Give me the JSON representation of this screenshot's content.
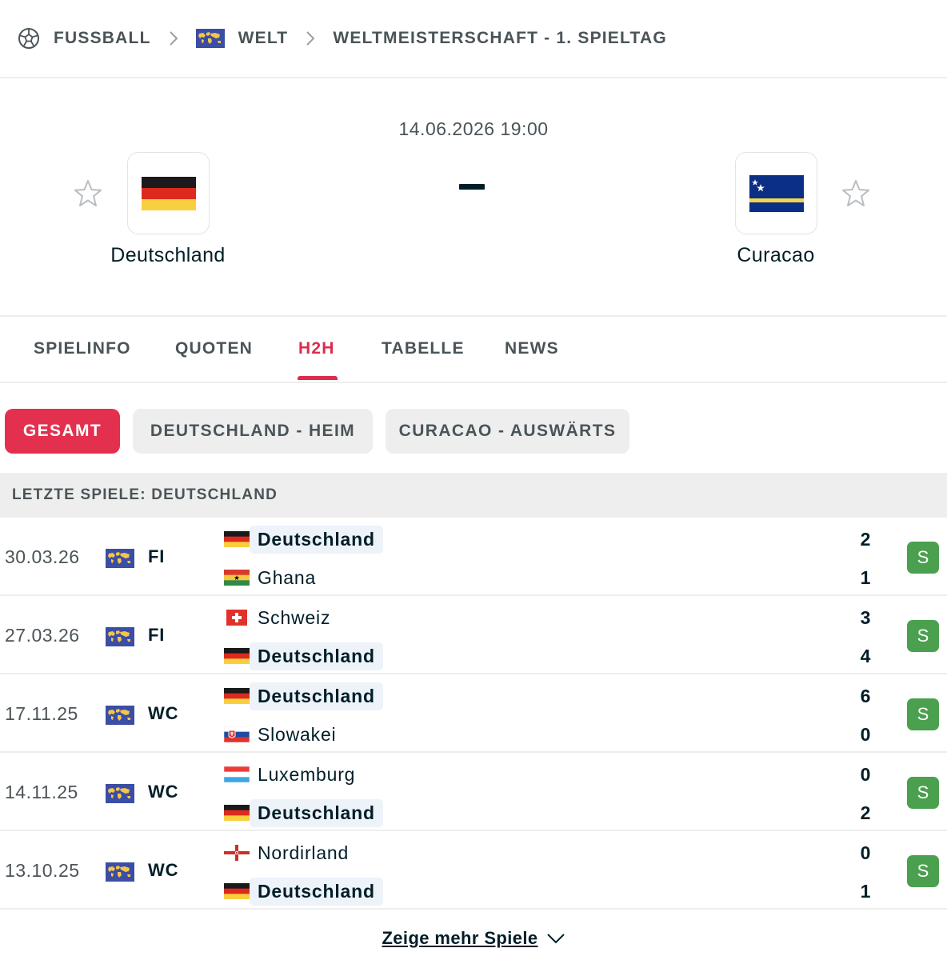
{
  "breadcrumb": {
    "sport": "FUSSBALL",
    "region": "WELT",
    "competition": "WELTMEISTERSCHAFT - 1. SPIELTAG",
    "icons": [
      "soccer-ball-icon",
      "world-flag-icon",
      "chevron-right-icon"
    ]
  },
  "match": {
    "datetime": "14.06.2026 19:00",
    "score_separator": "–",
    "home": {
      "name": "Deutschland",
      "flag": "germany-flag"
    },
    "away": {
      "name": "Curacao",
      "flag": "curacao-flag"
    }
  },
  "tabs": [
    {
      "label": "SPIELINFO",
      "active": false
    },
    {
      "label": "QUOTEN",
      "active": false
    },
    {
      "label": "H2H",
      "active": true
    },
    {
      "label": "TABELLE",
      "active": false
    },
    {
      "label": "NEWS",
      "active": false
    }
  ],
  "filters": [
    {
      "label": "GESAMT",
      "active": true
    },
    {
      "label": "DEUTSCHLAND - HEIM",
      "active": false
    },
    {
      "label": "CURACAO - AUSWÄRTS",
      "active": false
    }
  ],
  "section": {
    "title": "LETZTE SPIELE: DEUTSCHLAND"
  },
  "matches": [
    {
      "date": "30.03.26",
      "comp": "FI",
      "home": "Deutschland",
      "away": "Ghana",
      "home_score": "2",
      "away_score": "1",
      "result": "S"
    },
    {
      "date": "27.03.26",
      "comp": "FI",
      "home": "Schweiz",
      "away": "Deutschland",
      "home_score": "3",
      "away_score": "4",
      "result": "S"
    },
    {
      "date": "17.11.25",
      "comp": "WC",
      "home": "Deutschland",
      "away": "Slowakei",
      "home_score": "6",
      "away_score": "0",
      "result": "S"
    },
    {
      "date": "14.11.25",
      "comp": "WC",
      "home": "Luxemburg",
      "away": "Deutschland",
      "home_score": "0",
      "away_score": "2",
      "result": "S"
    },
    {
      "date": "13.10.25",
      "comp": "WC",
      "home": "Nordirland",
      "away": "Deutschland",
      "home_score": "0",
      "away_score": "1",
      "result": "S"
    }
  ],
  "show_more": {
    "label": "Zeige mehr Spiele"
  },
  "colors": {
    "accent": "#e3304f",
    "win": "#4aa04e",
    "text": "#001e28",
    "muted": "#4a5458",
    "highlight": "#edf3f9"
  }
}
